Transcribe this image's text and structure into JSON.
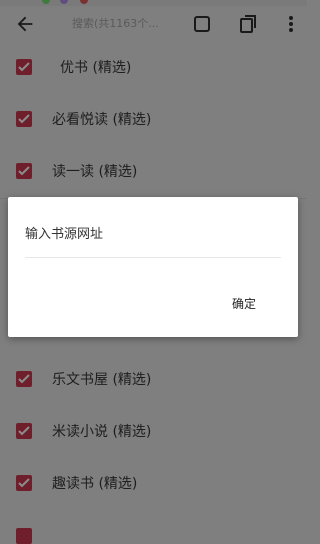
{
  "toolbar": {
    "search_placeholder": "搜索(共1163个...",
    "icons": [
      "back-icon",
      "select-all-icon",
      "copy-icon",
      "more-icon"
    ]
  },
  "list": {
    "items": [
      {
        "label": "优书 (精选)",
        "checked": true
      },
      {
        "label": "必看悦读 (精选)",
        "checked": true
      },
      {
        "label": "读一读 (精选)",
        "checked": true
      },
      {
        "label": "乐文书屋 (精选)",
        "checked": true
      },
      {
        "label": "米读小说 (精选)",
        "checked": true
      },
      {
        "label": "趣读书 (精选)",
        "checked": true
      }
    ]
  },
  "dialog": {
    "input_placeholder": "输入书源网址",
    "input_value": "",
    "ok_label": "确定"
  },
  "colors": {
    "accent": "#c2185b",
    "dimmed_background": "#7f7f7f",
    "dialog_background": "#ffffff"
  }
}
